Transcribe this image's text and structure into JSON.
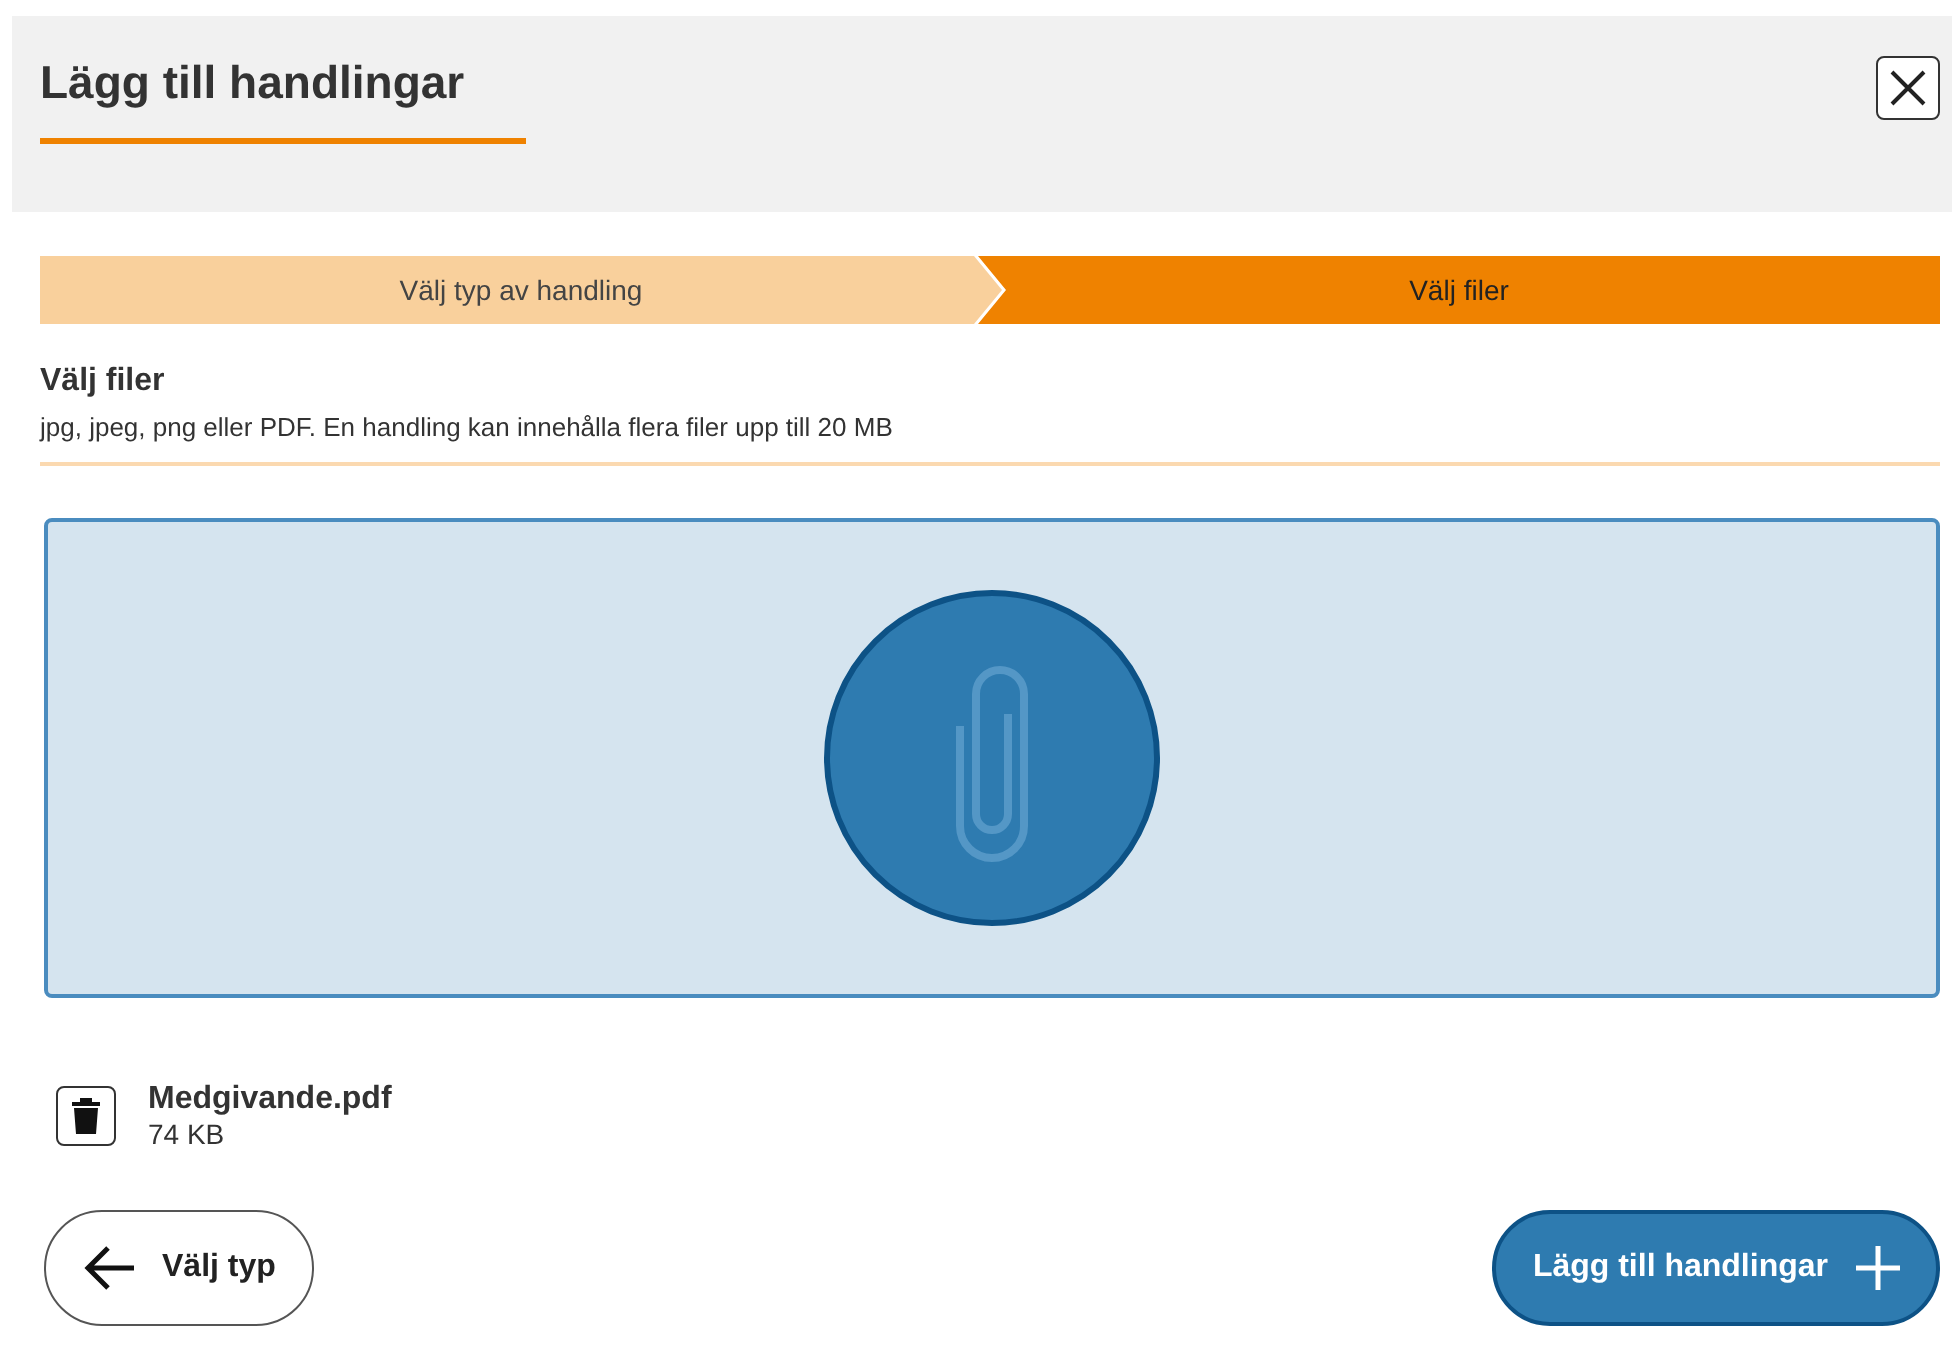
{
  "dialog": {
    "title": "Lägg till handlingar"
  },
  "steps": [
    {
      "label": "Välj typ av handling",
      "selected": false
    },
    {
      "label": "Välj filer",
      "selected": true
    }
  ],
  "section": {
    "heading": "Välj filer",
    "description": "jpg, jpeg, png eller PDF. En handling kan innehålla flera filer upp till 20 MB"
  },
  "files": [
    {
      "name": "Medgivande.pdf",
      "size": "74 KB"
    }
  ],
  "buttons": {
    "back": "Välj typ",
    "submit": "Lägg till handlingar"
  }
}
